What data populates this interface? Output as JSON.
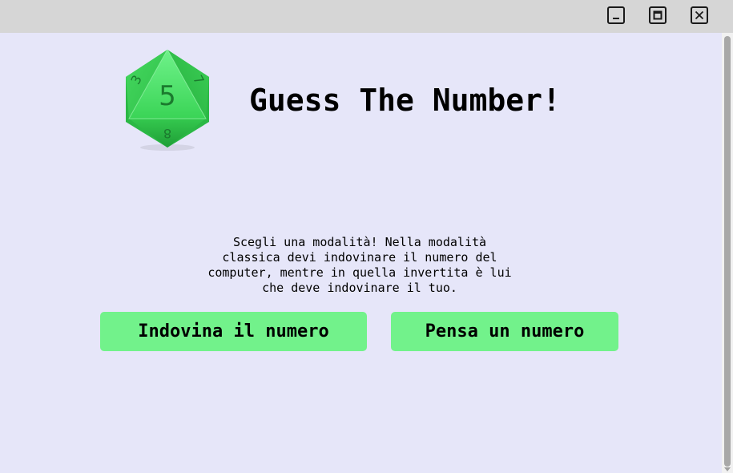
{
  "window": {
    "background": "#e6e6f9",
    "titlebar_color": "#d6d6d6",
    "controls": [
      "minimize-icon",
      "maximize-icon",
      "close-icon"
    ]
  },
  "logo": {
    "icon": "d8-dice-icon",
    "faces": [
      "5",
      "3",
      "7",
      "8"
    ],
    "color": "#3ddc5a"
  },
  "header": {
    "title": "Guess The Number!"
  },
  "main": {
    "description_lines": [
      "Scegli una modalità! Nella modalità",
      "classica devi indovinare il numero del",
      "computer, mentre in quella invertita è lui",
      "che deve indovinare il tuo."
    ],
    "buttons": {
      "guess_label": "Indovina il numero",
      "think_label": "Pensa un numero"
    },
    "accent": "#72f28b"
  }
}
